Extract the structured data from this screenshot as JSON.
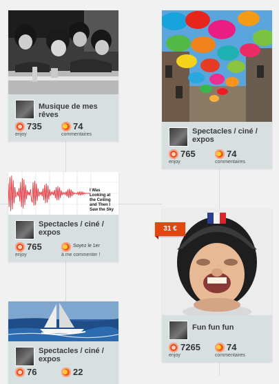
{
  "cards": [
    {
      "title": "Musique de mes rêves",
      "enjoy_count": "735",
      "enjoy_label": "enjoy",
      "comments_count": "74",
      "comments_label": "commentaires"
    },
    {
      "title": "Spectacles / ciné / expos",
      "enjoy_count": "765",
      "enjoy_label": "enjoy",
      "comments_count": "74",
      "comments_label": "commentaires"
    },
    {
      "title": "Spectacles / ciné / expos",
      "waveform_caption": "I Was Looking at the Ceiling and Then I Saw the Sky",
      "enjoy_count": "765",
      "enjoy_label": "enjoy",
      "comments_cta_line1": "Soyez le 1er",
      "comments_cta_line2": "à me commenter !"
    },
    {
      "title": "Fun fun fun",
      "price_badge": "31 €",
      "enjoy_count": "7265",
      "enjoy_label": "enjoy",
      "comments_count": "74",
      "comments_label": "commentaires"
    },
    {
      "title": "Spectacles / ciné / expos",
      "enjoy_count": "76",
      "comments_count": "22"
    }
  ]
}
